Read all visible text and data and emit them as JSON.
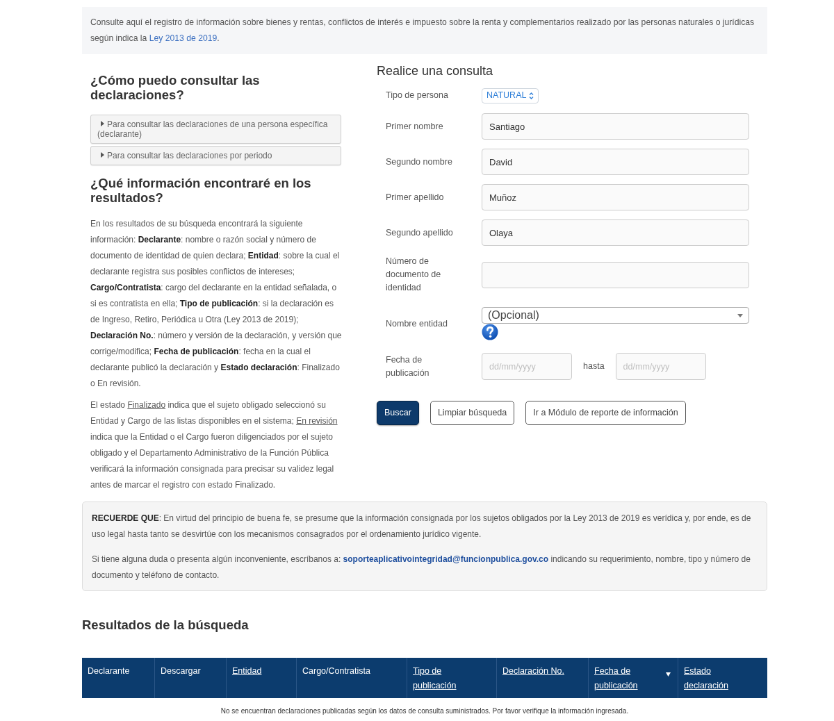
{
  "intro": {
    "text": "Consulte aquí el registro de información sobre bienes y rentas, conflictos de interés e impuesto sobre la renta y complementarios realizado por las personas naturales o jurídicas según indica la ",
    "link": "Ley 2013 de 2019",
    "after": "."
  },
  "help": {
    "title": "¿Cómo puedo consultar las declaraciones?",
    "accordion": [
      {
        "label": "Para consultar las declaraciones de una persona específica (declarante)",
        "expanded": false
      },
      {
        "label": "Para consultar las declaraciones por periodo",
        "expanded": false
      }
    ]
  },
  "results_info": {
    "title": "¿Qué información encontraré en los resultados?",
    "paragraph": "En los resultados de su búsqueda encontrará la siguiente información: **Declarante**: nombre o razón social y número de documento de identidad de quien declara; **Entidad**: sobre la cual el declarante registra sus posibles conflictos de intereses; **Cargo/Contratista**: cargo del declarante en la entidad señalada, o si es contratista en ella; **Tipo de publicación**: si la declaración es de Ingreso, Retiro, Periódica u Otra (Ley 2013 de 2019); **Declaración No.**: número y versión de la declaración, y versión que corrige/modifica; **Fecha de publicación**: fecha en la cual el declarante publicó la declaración y **Estado declaración**: Finalizado o En revisión.",
    "status_note": [
      {
        "text": "El estado ",
        "underlined": false
      },
      {
        "text": "Finalizado",
        "underlined": true
      },
      {
        "text": " indica que el sujeto obligado seleccionó su Entidad y Cargo de las listas disponibles en el sistema; ",
        "underlined": false
      },
      {
        "text": "En revisión",
        "underlined": true
      },
      {
        "text": " indica que la Entidad o el Cargo fueron diligenciados por el sujeto obligado y el Departamento Administrativo de la Función Pública verificará la información consignada para precisar su validez legal antes de marcar el registro con estado Finalizado.",
        "underlined": false
      }
    ]
  },
  "form": {
    "title": "Realice una consulta",
    "fields": [
      {
        "kind": "select",
        "label": "Tipo de persona",
        "value": "NATURAL"
      },
      {
        "kind": "text",
        "label": "Primer nombre",
        "value": "Santiago"
      },
      {
        "kind": "text",
        "label": "Segundo nombre",
        "value": "David"
      },
      {
        "kind": "text",
        "label": "Primer apellido",
        "value": "Muñoz"
      },
      {
        "kind": "text",
        "label": "Segundo apellido",
        "value": "Olaya"
      },
      {
        "kind": "text",
        "label": "Número de documento de identidad"
      },
      {
        "kind": "combo",
        "label": "Nombre entidad",
        "value": "(Opcional)"
      },
      {
        "kind": "date_range",
        "label": "Fecha de publicación",
        "from_placeholder": "dd/mm/yyyy",
        "separator": "hasta",
        "to_placeholder": "dd/mm/yyyy"
      }
    ],
    "buttons": [
      {
        "label": "Buscar",
        "primary": true
      },
      {
        "label": "Limpiar búsqueda",
        "primary": false
      },
      {
        "label": "Ir a Módulo de reporte de información",
        "primary": false
      }
    ]
  },
  "notice": {
    "text": "**RECUERDE QUE**: En virtud del principio de buena fe, se presume que la información consignada por los sujetos obligados por la Ley 2013 de 2019 es verídica y, por ende, es de uso legal hasta tanto se desvirtúe con los mecanismos consagrados por el ordenamiento jurídico vigente.",
    "contact": {
      "before": "Si tiene alguna duda o presenta algún inconveniente, escríbanos a: ",
      "email": "soporteaplicativointegridad@funcionpublica.gov.co",
      "after": " indicando su requerimiento, nombre, tipo y número de documento y teléfono de contacto."
    }
  },
  "results": {
    "title": "Resultados de la búsqueda",
    "columns": [
      {
        "label": "Declarante",
        "link": false,
        "sorted": false
      },
      {
        "label": "Descargar",
        "link": false,
        "sorted": false
      },
      {
        "label": "Entidad",
        "link": true,
        "sorted": false
      },
      {
        "label": "Cargo/Contratista",
        "link": false,
        "sorted": false
      },
      {
        "label": "Tipo de publicación",
        "link": true,
        "sorted": false
      },
      {
        "label": "Declaración No.",
        "link": true,
        "sorted": false
      },
      {
        "label": "Fecha de publicación",
        "link": true,
        "sorted": true
      },
      {
        "label": "Estado declaración",
        "link": true,
        "sorted": false
      }
    ],
    "empty_message": "No se encuentran declaraciones publicadas según los datos de consulta suministrados. Por favor verifique la información ingresada."
  }
}
